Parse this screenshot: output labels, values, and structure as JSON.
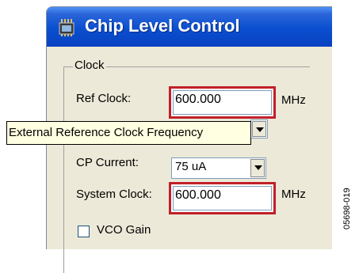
{
  "window": {
    "title": "Chip Level Control",
    "icon": "chip-app-icon"
  },
  "group": {
    "title": "Clock"
  },
  "fields": {
    "ref_clock": {
      "label": "Ref Clock:",
      "value": "600.000",
      "unit": "MHz"
    },
    "cp_current": {
      "label": "CP Current:",
      "value": "75 uA"
    },
    "system_clock": {
      "label": "System Clock:",
      "value": "600.000",
      "unit": "MHz"
    },
    "vco_gain": {
      "label": "VCO Gain",
      "checked": false
    }
  },
  "tooltip": {
    "text": "External Reference Clock Frequency"
  },
  "figure_id": "05698-019",
  "colors": {
    "highlight": "#c0202a",
    "titlebar": "#0a4fd0"
  }
}
